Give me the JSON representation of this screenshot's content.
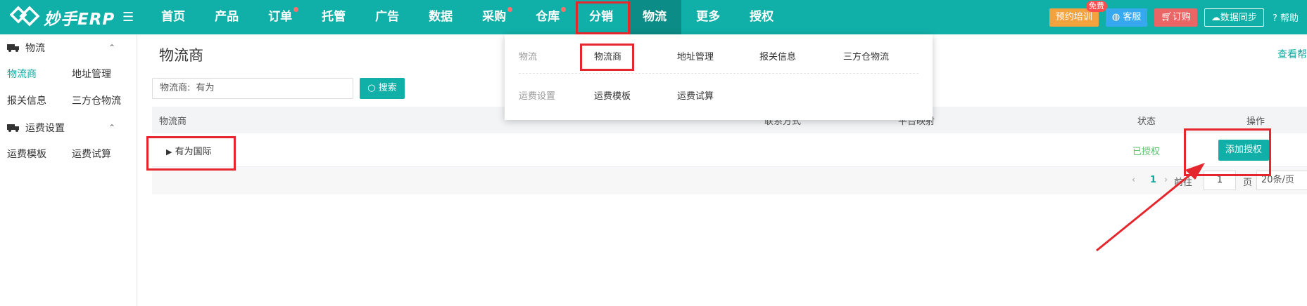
{
  "app": {
    "logo_text": "妙手ERP"
  },
  "nav": {
    "items": [
      {
        "label": "首页",
        "dot": false
      },
      {
        "label": "产品",
        "dot": false
      },
      {
        "label": "订单",
        "dot": true
      },
      {
        "label": "托管",
        "dot": false
      },
      {
        "label": "广告",
        "dot": false
      },
      {
        "label": "数据",
        "dot": false
      },
      {
        "label": "采购",
        "dot": true
      },
      {
        "label": "仓库",
        "dot": true
      },
      {
        "label": "分销",
        "dot": false
      },
      {
        "label": "物流",
        "dot": false,
        "active": true
      },
      {
        "label": "更多",
        "dot": false
      },
      {
        "label": "授权",
        "dot": false
      }
    ]
  },
  "top_right": {
    "training": "预约培训",
    "free_badge": "免费",
    "service": "客服",
    "order": "订购",
    "sync": "数据同步",
    "help": "帮助"
  },
  "sidebar": {
    "groups": [
      {
        "title": "物流",
        "items": [
          "物流商",
          "地址管理",
          "报关信息",
          "三方仓物流"
        ]
      },
      {
        "title": "运费设置",
        "items": [
          "运费模板",
          "运费试算"
        ]
      }
    ]
  },
  "main": {
    "title": "物流商",
    "view_link": "查看帮",
    "search": {
      "label": "物流商:",
      "value": "有为",
      "button": "搜索"
    },
    "table": {
      "headers": {
        "provider": "物流商",
        "contact": "联系方式",
        "platform": "平台映射",
        "status": "状态",
        "action": "操作"
      },
      "rows": [
        {
          "name": "有为国际",
          "status": "已授权",
          "action": "添加授权"
        }
      ]
    },
    "pager": {
      "current": "1",
      "goto": "前往",
      "page_value": "1",
      "page_unit": "页",
      "size": "20条/页"
    }
  },
  "dropdown": {
    "rows": [
      {
        "label": "物流",
        "items": [
          "物流商",
          "地址管理",
          "报关信息",
          "三方仓物流"
        ]
      },
      {
        "label": "运费设置",
        "items": [
          "运费模板",
          "运费试算"
        ]
      }
    ]
  },
  "colors": {
    "brand": "#10b0a8",
    "brand_dark": "#0c8c86",
    "highlight": "#e5262d",
    "success": "#5ac26b"
  }
}
